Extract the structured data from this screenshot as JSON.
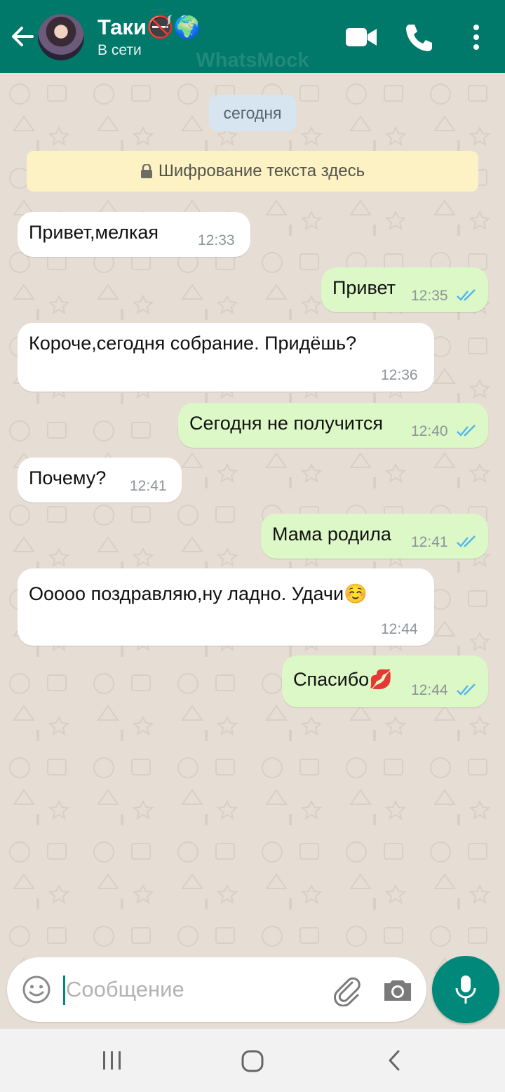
{
  "header": {
    "contact_name": "Таки🚭🌍",
    "status": "В сети",
    "watermark": "WhatsMock"
  },
  "chat": {
    "date_label": "сегодня",
    "encryption_notice": "Шифрование текста здесь",
    "messages": [
      {
        "direction": "incoming",
        "text": "Привет,мелкая",
        "time": "12:33"
      },
      {
        "direction": "outgoing",
        "text": "Привет",
        "time": "12:35",
        "status": "read"
      },
      {
        "direction": "incoming",
        "text": "Короче,сегодня собрание. Придёшь?",
        "time": "12:36"
      },
      {
        "direction": "outgoing",
        "text": "Сегодня не получится",
        "time": "12:40",
        "status": "read"
      },
      {
        "direction": "incoming",
        "text": "Почему?",
        "time": "12:41"
      },
      {
        "direction": "outgoing",
        "text": "Мама родила",
        "time": "12:41",
        "status": "read"
      },
      {
        "direction": "incoming",
        "text": "Ооооо поздравляю,ну ладно. Удачи☺️",
        "time": "12:44"
      },
      {
        "direction": "outgoing",
        "text": "Спасибо💋",
        "time": "12:44",
        "status": "read"
      }
    ]
  },
  "composer": {
    "placeholder": "Сообщение"
  },
  "icons": {
    "back": "arrow-left-icon",
    "video": "video-camera-icon",
    "call": "phone-icon",
    "menu": "more-vertical-icon",
    "emoji": "emoji-icon",
    "attach": "paperclip-icon",
    "camera": "camera-icon",
    "mic": "microphone-icon",
    "lock": "lock-icon",
    "read_receipt": "double-check-icon"
  },
  "colors": {
    "header": "#00786a",
    "chat_background": "#e6ddd4",
    "outgoing_bubble": "#dcf8c6",
    "incoming_bubble": "#ffffff",
    "read_ticks": "#4fb6ec",
    "accent": "#00897b"
  }
}
